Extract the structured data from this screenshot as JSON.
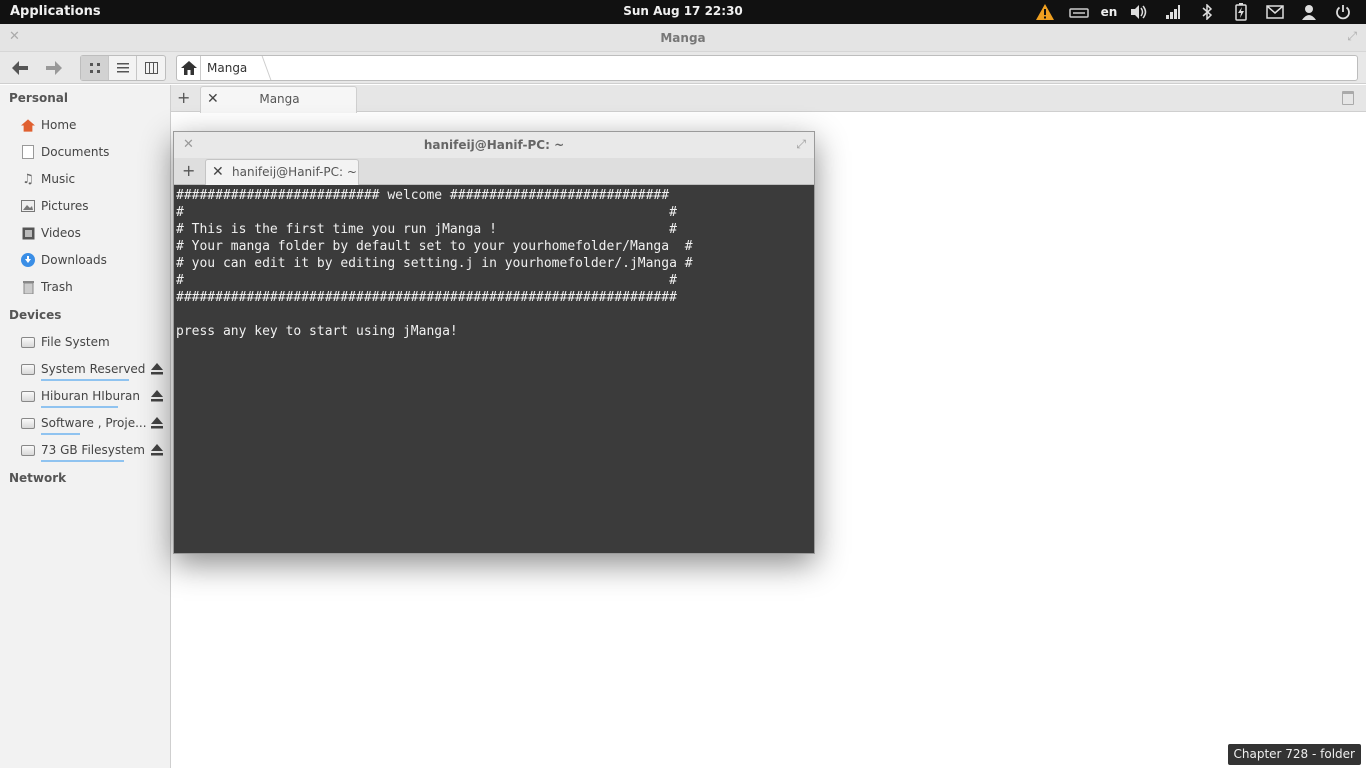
{
  "panel": {
    "applications_label": "Applications",
    "clock": "Sun Aug 17 22:30",
    "language": "en",
    "tray_icons": [
      "warning-icon",
      "keyboard-icon",
      "volume-icon",
      "signal-icon",
      "bluetooth-icon",
      "battery-icon",
      "mail-icon",
      "user-icon",
      "power-icon"
    ],
    "warning_color": "#f0a020"
  },
  "file_manager": {
    "title": "Manga",
    "path": [
      "Manga"
    ],
    "view_modes": [
      "grid-view-icon",
      "list-view-icon",
      "column-view-icon"
    ],
    "active_view": 0,
    "tab_label": "Manga",
    "sidebar": {
      "personal_heading": "Personal",
      "personal_items": [
        {
          "label": "Home",
          "icon": "home-icon"
        },
        {
          "label": "Documents",
          "icon": "documents-icon"
        },
        {
          "label": "Music",
          "icon": "music-icon"
        },
        {
          "label": "Pictures",
          "icon": "pictures-icon"
        },
        {
          "label": "Videos",
          "icon": "videos-icon"
        },
        {
          "label": "Downloads",
          "icon": "downloads-icon"
        },
        {
          "label": "Trash",
          "icon": "trash-icon"
        }
      ],
      "devices_heading": "Devices",
      "device_items": [
        {
          "label": "File System",
          "usage": 0
        },
        {
          "label": "System Reserved",
          "usage": 0.8
        },
        {
          "label": "Hiburan HIburan",
          "usage": 0.7
        },
        {
          "label": "Software , Proje...",
          "usage": 0.35
        },
        {
          "label": "73 GB Filesystem",
          "usage": 0.75
        }
      ],
      "network_heading": "Network"
    },
    "status_tooltip": "Chapter 728 - folder"
  },
  "terminal": {
    "title": "hanifeij@Hanif-PC: ~",
    "tab_label": "hanifeij@Hanif-PC: ~",
    "background": "#3b3b3b",
    "lines": [
      "########################## welcome ############################",
      "#                                                              #",
      "# This is the first time you run jManga !                      #",
      "# Your manga folder by default set to your yourhomefolder/Manga  #",
      "# you can edit it by editing setting.j in yourhomefolder/.jManga #",
      "#                                                              #",
      "################################################################",
      "",
      "press any key to start using jManga!"
    ]
  }
}
